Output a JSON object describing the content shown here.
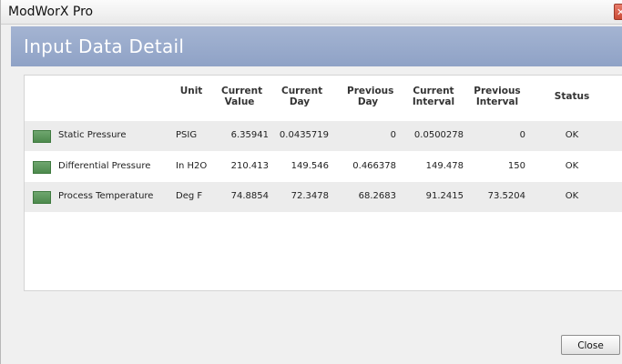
{
  "window": {
    "app_title": "ModWorX Pro",
    "close_glyph": "✕"
  },
  "header": {
    "title": "Input Data Detail"
  },
  "table": {
    "columns": [
      "Unit",
      "Current\nValue",
      "Current\nDay",
      "Previous\nDay",
      "Current\nInterval",
      "Previous\nInterval",
      "Status"
    ],
    "rows": [
      {
        "name": "Static Pressure",
        "unit": "PSIG",
        "current_value": "6.35941",
        "current_day": "0.0435719",
        "previous_day": "0",
        "current_interval": "0.0500278",
        "previous_interval": "0",
        "status": "OK"
      },
      {
        "name": "Differential Pressure",
        "unit": "In H2O",
        "current_value": "210.413",
        "current_day": "149.546",
        "previous_day": "0.466378",
        "current_interval": "149.478",
        "previous_interval": "150",
        "status": "OK"
      },
      {
        "name": "Process Temperature",
        "unit": "Deg F",
        "current_value": "74.8854",
        "current_day": "72.3478",
        "previous_day": "68.2683",
        "current_interval": "91.2415",
        "previous_interval": "73.5204",
        "status": "OK"
      }
    ]
  },
  "footer": {
    "close_label": "Close"
  },
  "colors": {
    "header_band": "#98a9cb",
    "swatch": "#5a965a",
    "row_shade": "#ececec"
  }
}
